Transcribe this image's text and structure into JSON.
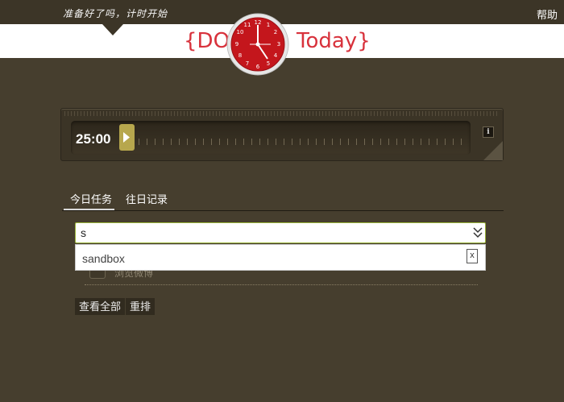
{
  "header": {
    "tagline": "准备好了吗，计时开始",
    "help_label": "帮助",
    "logo_left": "{DO",
    "logo_right": "Today}"
  },
  "timer": {
    "time": "25:00",
    "info_label": "i"
  },
  "tabs": [
    {
      "label": "今日任务",
      "active": true
    },
    {
      "label": "往日记录",
      "active": false
    }
  ],
  "search": {
    "value": "s",
    "dropdown_items": [
      {
        "label": "sandbox"
      }
    ],
    "close_label": "x"
  },
  "task": {
    "partial_text": "浏览微博"
  },
  "actions": {
    "view_all_label": "查看全部",
    "reorder_label": "重排"
  },
  "colors": {
    "background": "#463e2e",
    "logo_red": "#d8323c",
    "handle": "#b7a74d",
    "focus_border": "#9ab43a"
  },
  "icons": [
    "clock-logo-icon",
    "play-icon",
    "info-icon",
    "chevron-down-icon",
    "close-icon"
  ]
}
